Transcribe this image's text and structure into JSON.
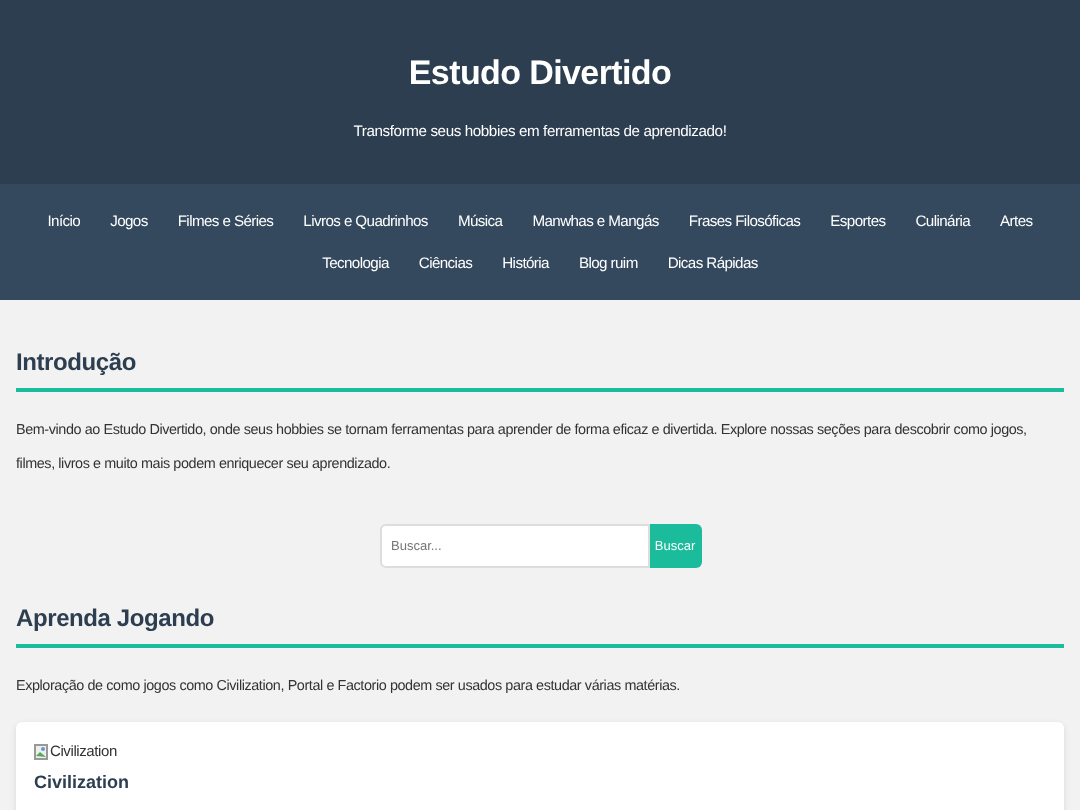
{
  "header": {
    "title": "Estudo Divertido",
    "subtitle": "Transforme seus hobbies em ferramentas de aprendizado!"
  },
  "nav": [
    "Início",
    "Jogos",
    "Filmes e Séries",
    "Livros e Quadrinhos",
    "Música",
    "Manwhas e Mangás",
    "Frases Filosóficas",
    "Esportes",
    "Culinária",
    "Artes",
    "Tecnologia",
    "Ciências",
    "História",
    "Blog ruim",
    "Dicas Rápidas"
  ],
  "sections": [
    {
      "title": "Introdução",
      "text": "Bem-vindo ao Estudo Divertido, onde seus hobbies se tornam ferramentas para aprender de forma eficaz e divertida. Explore nossas seções para descobrir como jogos, filmes, livros e muito mais podem enriquecer seu aprendizado.",
      "search": {
        "placeholder": "Buscar...",
        "button": "Buscar"
      }
    },
    {
      "title": "Aprenda Jogando",
      "text": "Exploração de como jogos como Civilization, Portal e Factorio podem ser usados para estudar várias matérias.",
      "cards": [
        {
          "image_alt": "Civilization",
          "title": "Civilization"
        }
      ]
    }
  ]
}
